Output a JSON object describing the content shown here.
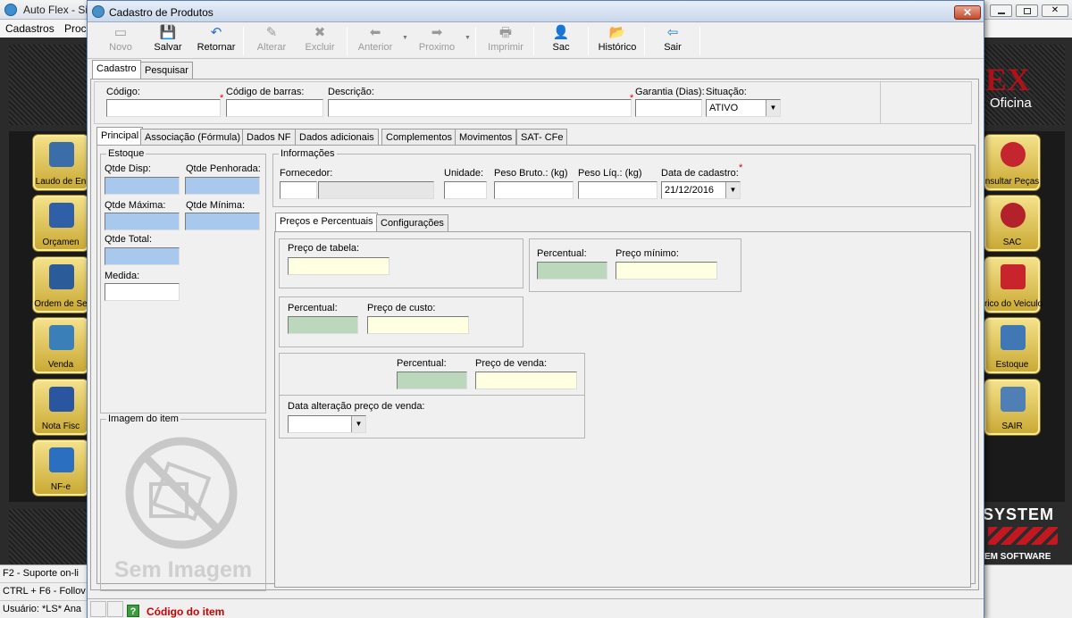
{
  "background_app": {
    "title": "Auto Flex - Si",
    "menu": [
      "Cadastros",
      "Proc"
    ],
    "brand_partial": "EX",
    "brand_sub": "Oficina",
    "brand_bottom": "SYSTEM",
    "brand_bottom_sub": "EM SOFTWARE",
    "left_tiles": [
      "Laudo de En",
      "Orçamen",
      "Ordem de Se",
      "Venda",
      "Nota Fisc",
      "NF-e"
    ],
    "right_tiles": [
      "nsultar Peças",
      "SAC",
      "rico do Veiculo",
      "Estoque",
      "SAIR"
    ],
    "status_lines": [
      "F2 - Suporte on-li",
      "CTRL + F6 - Follov",
      "Usuário: *LS* Ana"
    ],
    "status_hint": "Código do item",
    "status_hint_icon": "?"
  },
  "dialog": {
    "title": "Cadastro de Produtos",
    "close": "✕",
    "toolbar": [
      {
        "label": "Novo",
        "icon": "new-icon",
        "glyph": "▭",
        "enabled": false
      },
      {
        "label": "Salvar",
        "icon": "save-icon",
        "glyph": "💾",
        "enabled": true
      },
      {
        "label": "Retornar",
        "icon": "undo-icon",
        "glyph": "↶",
        "enabled": true
      },
      {
        "label": "Alterar",
        "icon": "edit-icon",
        "glyph": "✎",
        "enabled": false
      },
      {
        "label": "Excluir",
        "icon": "delete-icon",
        "glyph": "✖",
        "enabled": false
      },
      {
        "label": "Anterior",
        "icon": "arrow-left-icon",
        "glyph": "⬅",
        "enabled": false
      },
      {
        "label": "Proximo",
        "icon": "arrow-right-icon",
        "glyph": "➡",
        "enabled": false
      },
      {
        "label": "Imprimir",
        "icon": "print-icon",
        "glyph": "🖶",
        "enabled": false
      },
      {
        "label": "Sac",
        "icon": "user-icon",
        "glyph": "👤",
        "enabled": true
      },
      {
        "label": "Histórico",
        "icon": "folder-icon",
        "glyph": "📂",
        "enabled": true
      },
      {
        "label": "Sair",
        "icon": "exit-icon",
        "glyph": "⇦",
        "enabled": true
      }
    ],
    "top_tabs": [
      "Cadastro",
      "Pesquisar"
    ],
    "header_fields": {
      "codigo": {
        "label": "Código:",
        "value": ""
      },
      "codigo_barras": {
        "label": "Código de barras:",
        "value": ""
      },
      "descricao": {
        "label": "Descrição:",
        "value": ""
      },
      "garantia": {
        "label": "Garantia (Dias):",
        "value": ""
      },
      "situacao": {
        "label": "Situação:",
        "value": "ATIVO"
      }
    },
    "inner_tabs": [
      "Principal",
      "Associação (Fórmula)",
      "Dados NF",
      "Dados adicionais",
      "Complementos",
      "Movimentos",
      "SAT- CFe"
    ],
    "estoque": {
      "caption": "Estoque",
      "qtde_disp": "Qtde Disp:",
      "qtde_penhorada": "Qtde Penhorada:",
      "qtde_maxima": "Qtde Máxima:",
      "qtde_minima": "Qtde Mínima:",
      "qtde_total": "Qtde Total:",
      "medida": "Medida:"
    },
    "imagem": {
      "caption": "Imagem do item",
      "placeholder": "Sem Imagem"
    },
    "informacoes": {
      "caption": "Informações",
      "fornecedor": "Fornecedor:",
      "unidade": "Unidade:",
      "peso_bruto": "Peso Bruto.: (kg)",
      "peso_liq": "Peso Líq.: (kg)",
      "data_cadastro": "Data de cadastro:",
      "data_cadastro_value": "21/12/2016"
    },
    "preco_tabs": [
      "Preços e Percentuais",
      "Configurações"
    ],
    "precos": {
      "preco_tabela": "Preço de tabela:",
      "percentual": "Percentual:",
      "preco_minimo": "Preço mínimo:",
      "preco_custo": "Preço de custo:",
      "preco_venda": "Preço de venda:",
      "data_alteracao": "Data alteração preço de venda:"
    },
    "required_mark": "*",
    "dropdown_arrow": "▼"
  }
}
